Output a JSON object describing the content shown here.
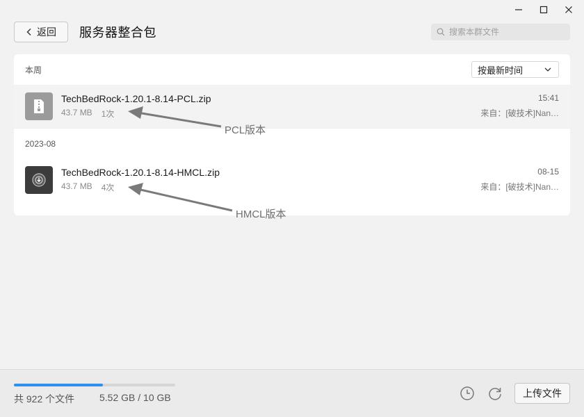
{
  "window_controls": {
    "minimize": "minimize",
    "maximize": "maximize",
    "close": "close"
  },
  "header": {
    "back_label": "返回",
    "title": "服务器整合包",
    "search": {
      "placeholder": "搜索本群文件",
      "value": ""
    }
  },
  "groups": [
    {
      "label": "本周",
      "sort_label": "按最新时间",
      "files": [
        {
          "name": "TechBedRock-1.20.1-8.14-PCL.zip",
          "size": "43.7 MB",
          "downloads": "1次",
          "time": "15:41",
          "source": "来自：[破技术]Nan…",
          "icon": "zip-file-icon"
        }
      ]
    },
    {
      "label": "2023-08",
      "files": [
        {
          "name": "TechBedRock-1.20.1-8.14-HMCL.zip",
          "size": "43.7 MB",
          "downloads": "4次",
          "time": "08-15",
          "source": "来自：[破技术]Nan…",
          "icon": "hmcl-app-icon"
        }
      ]
    }
  ],
  "annotations": [
    {
      "label": "PCL版本"
    },
    {
      "label": "HMCL版本"
    }
  ],
  "footer": {
    "file_count": "共 922 个文件",
    "storage": "5.52 GB / 10 GB",
    "storage_used_fraction": 0.55,
    "upload_label": "上传文件"
  },
  "colors": {
    "accent": "#2e8ff0",
    "background": "#f2f2f2"
  }
}
